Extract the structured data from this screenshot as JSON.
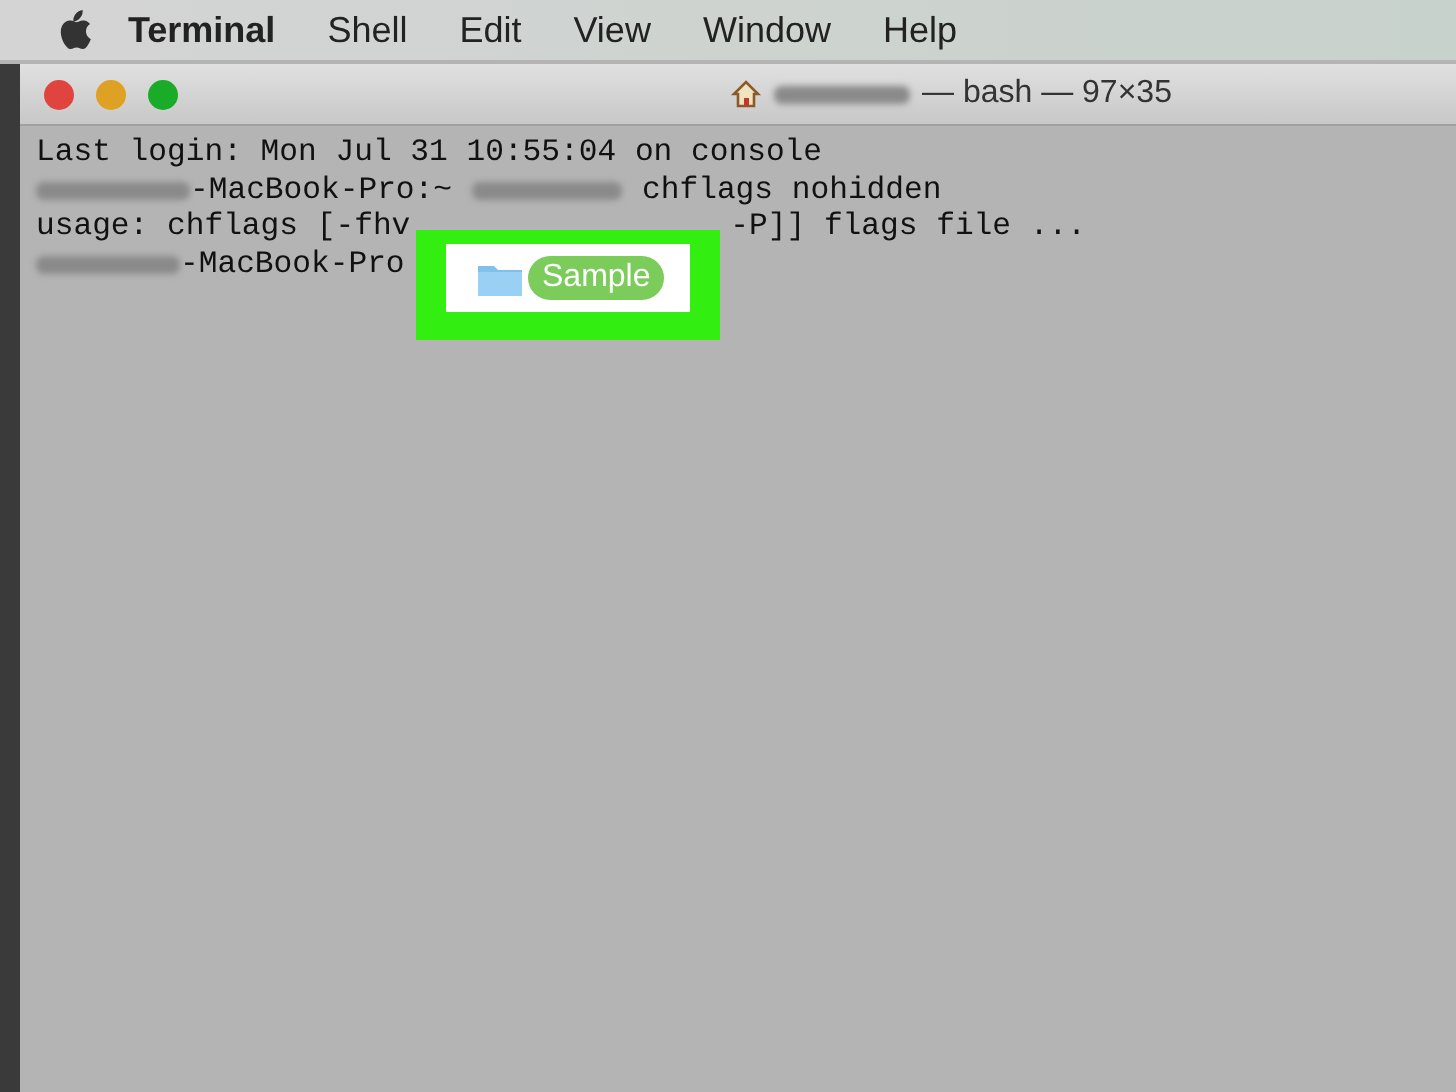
{
  "menu_bar": {
    "items": [
      {
        "label": "Terminal",
        "bold": true
      },
      {
        "label": "Shell",
        "bold": false
      },
      {
        "label": "Edit",
        "bold": false
      },
      {
        "label": "View",
        "bold": false
      },
      {
        "label": "Window",
        "bold": false
      },
      {
        "label": "Help",
        "bold": false
      }
    ]
  },
  "window": {
    "title": "— bash — 97×35"
  },
  "terminal_lines": [
    {
      "segments": [
        {
          "kind": "text",
          "text": "Last login: Mon Jul 31 10:55:04 on console"
        }
      ]
    },
    {
      "segments": [
        {
          "kind": "redacted"
        },
        {
          "kind": "text",
          "text": "-MacBook-Pro:~"
        },
        {
          "kind": "redacted"
        },
        {
          "kind": "text",
          "text": "chflags nohidden"
        }
      ]
    },
    {
      "segments": [
        {
          "kind": "text",
          "text": "usage: chflags [-fhv"
        },
        {
          "kind": "covered"
        },
        {
          "kind": "text",
          "text": "-P]] flags file ..."
        }
      ]
    },
    {
      "segments": [
        {
          "kind": "redacted"
        },
        {
          "kind": "text",
          "text": "-MacBook-Pro"
        }
      ]
    }
  ],
  "callout": {
    "tag": "Sample"
  }
}
